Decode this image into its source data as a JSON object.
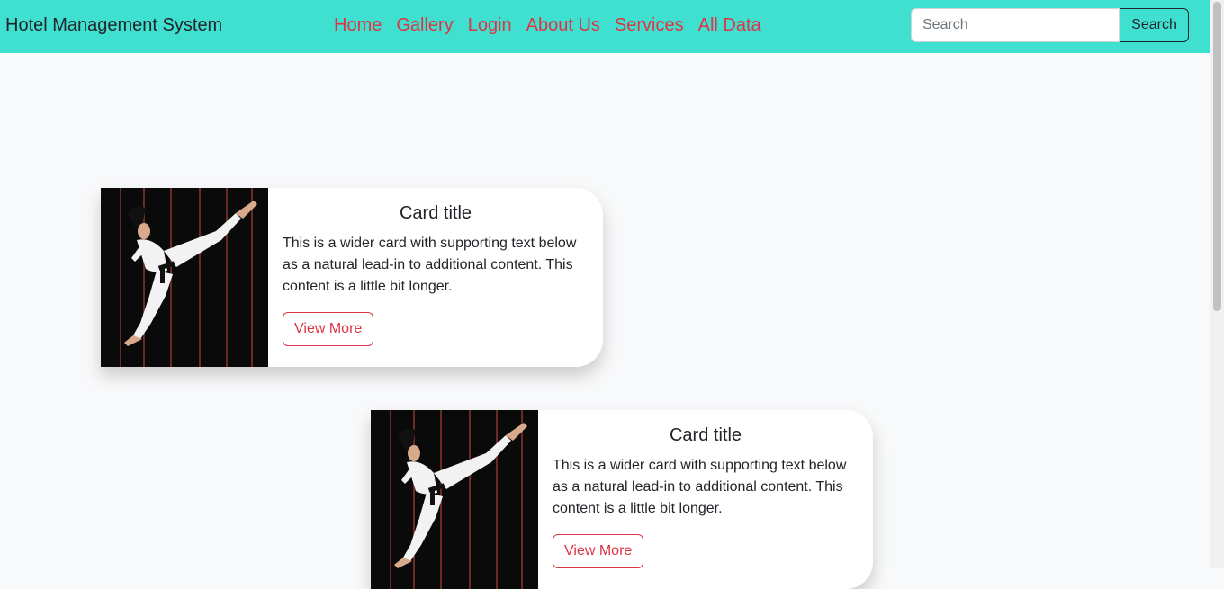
{
  "navbar": {
    "brand": "Hotel Management System",
    "links": [
      "Home",
      "Gallery",
      "Login",
      "About Us",
      "Services",
      "All Data"
    ],
    "search_placeholder": "Search",
    "search_button": "Search",
    "background_color": "#40e0d0",
    "link_color": "#dc3545"
  },
  "cards": [
    {
      "title": "Card title",
      "text": "This is a wider card with supporting text below as a natural lead-in to additional content. This content is a little bit longer.",
      "button": "View More"
    },
    {
      "title": "Card title",
      "text": "This is a wider card with supporting text below as a natural lead-in to additional content. This content is a little bit longer.",
      "button": "View More"
    }
  ]
}
